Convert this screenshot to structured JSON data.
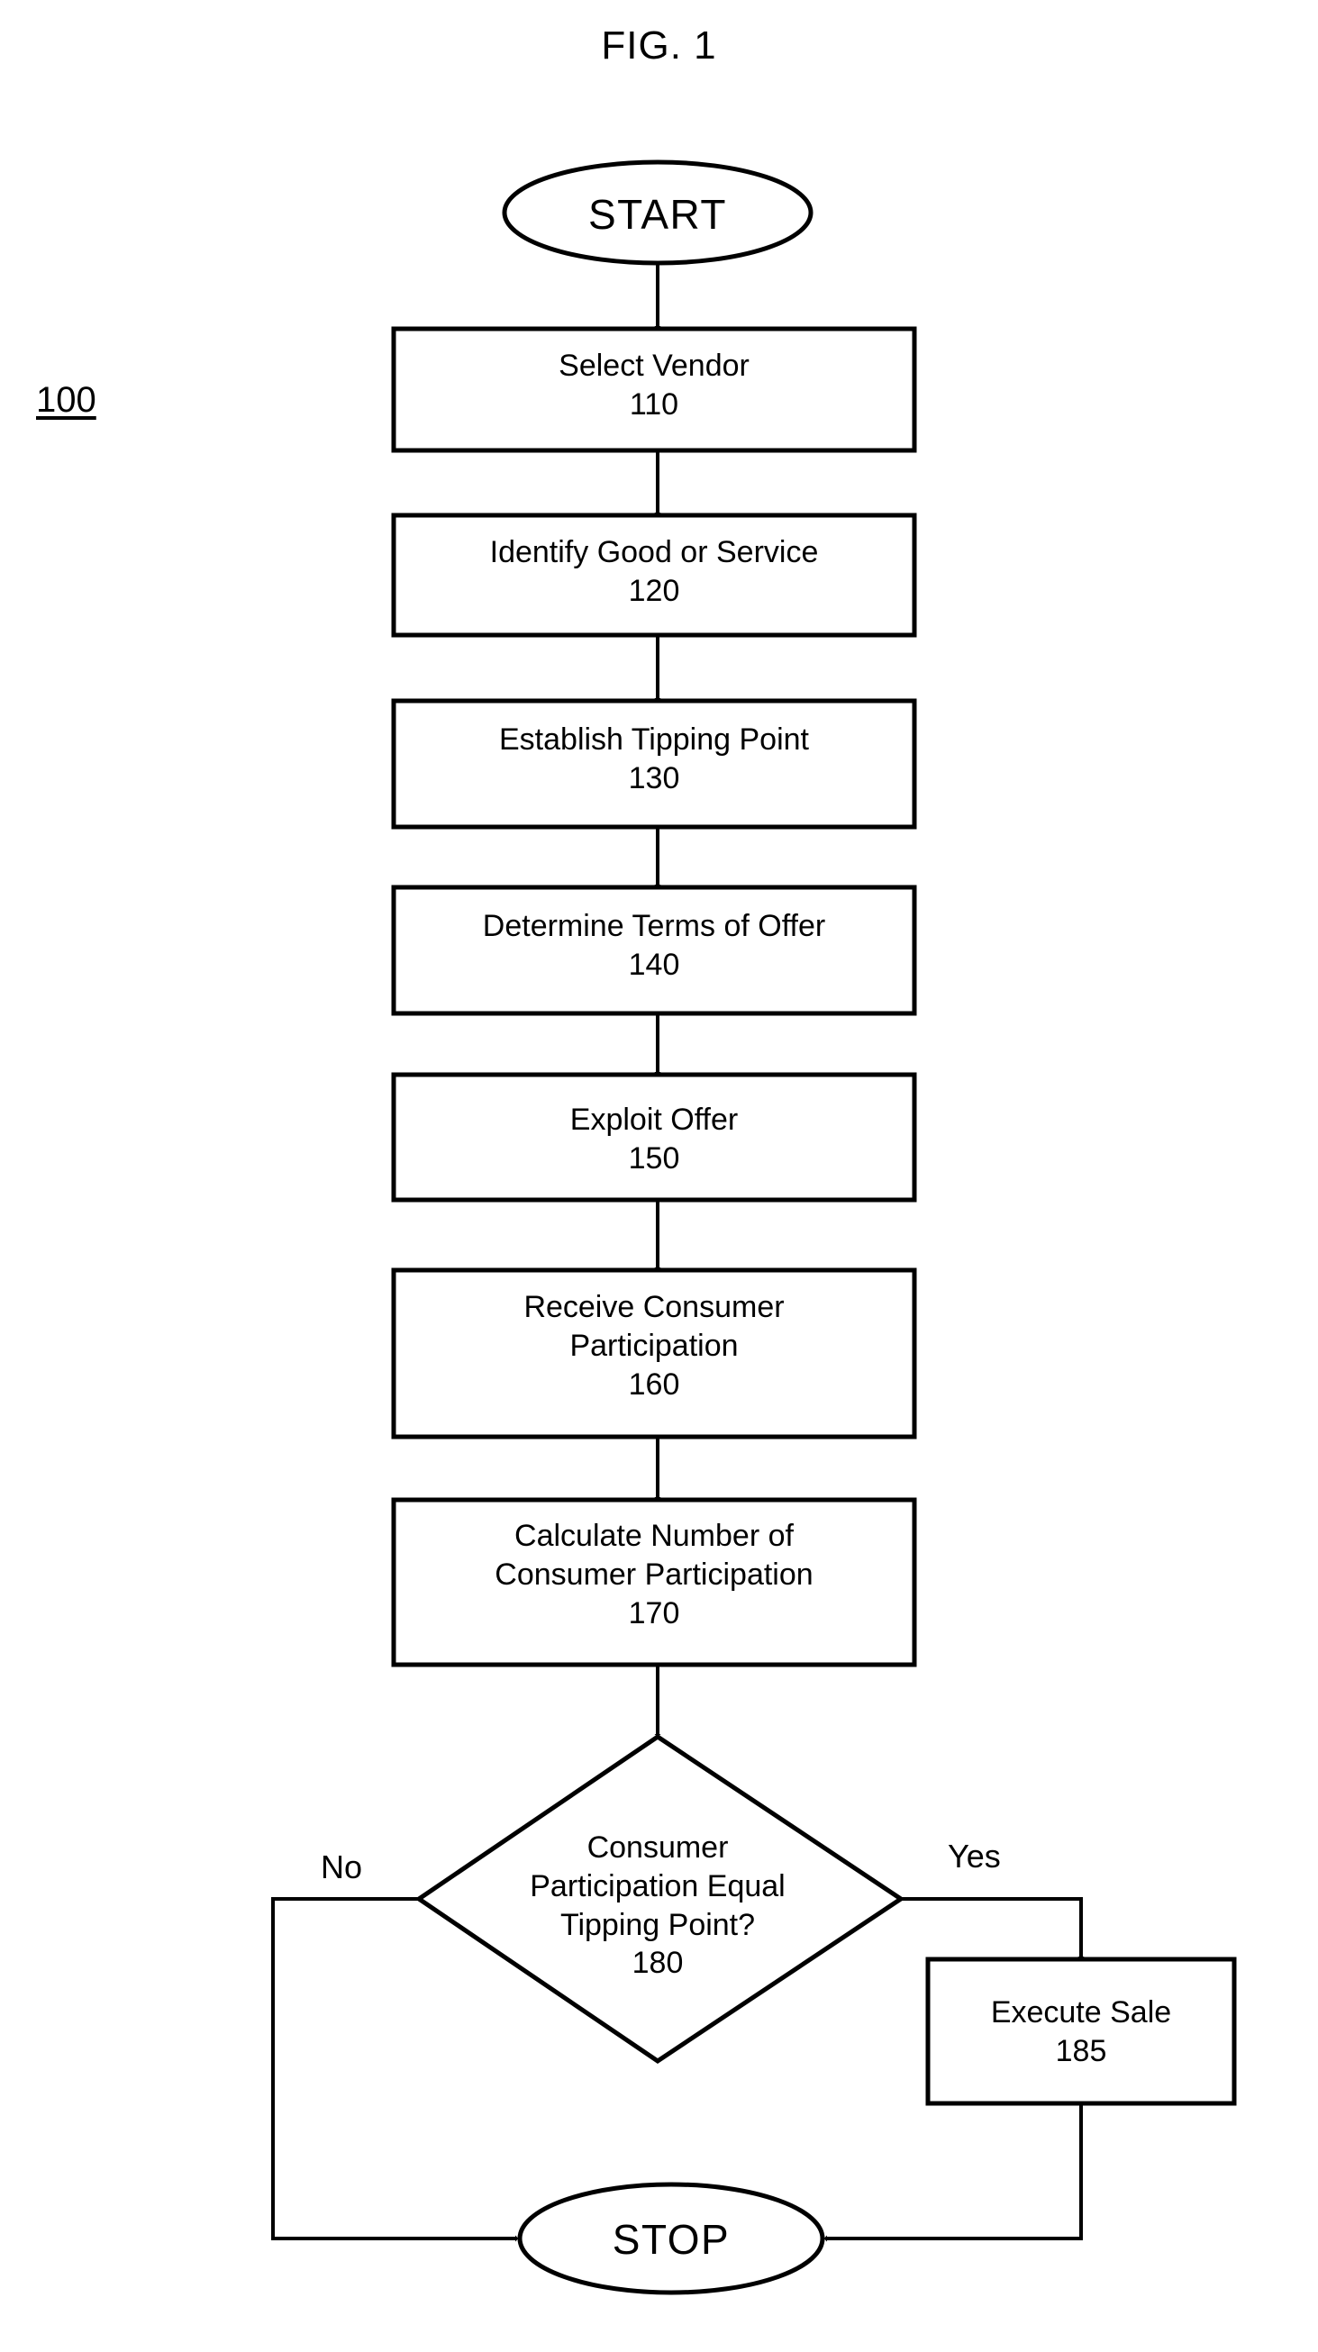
{
  "figure": {
    "title": "FIG. 1",
    "reference_numeral": "100"
  },
  "nodes": {
    "start": {
      "label": "START",
      "shape": "terminator"
    },
    "step110": {
      "label": "Select Vendor",
      "numeral": "110",
      "shape": "process"
    },
    "step120": {
      "label": "Identify Good or Service",
      "numeral": "120",
      "shape": "process"
    },
    "step130": {
      "label": "Establish Tipping Point",
      "numeral": "130",
      "shape": "process"
    },
    "step140": {
      "label": "Determine Terms of Offer",
      "numeral": "140",
      "shape": "process"
    },
    "step150": {
      "label": "Exploit Offer",
      "numeral": "150",
      "shape": "process"
    },
    "step160": {
      "label_line1": "Receive Consumer",
      "label_line2": "Participation",
      "numeral": "160",
      "shape": "process"
    },
    "step170": {
      "label_line1": "Calculate Number of",
      "label_line2": "Consumer Participation",
      "numeral": "170",
      "shape": "process"
    },
    "decision180": {
      "label_line1": "Consumer",
      "label_line2": "Participation Equal",
      "label_line3": "Tipping Point?",
      "numeral": "180",
      "shape": "decision"
    },
    "step185": {
      "label": "Execute Sale",
      "numeral": "185",
      "shape": "process"
    },
    "stop": {
      "label": "STOP",
      "shape": "terminator"
    }
  },
  "branches": {
    "no": "No",
    "yes": "Yes"
  },
  "style": {
    "stroke": "#000000",
    "fill": "#ffffff",
    "background": "#ffffff"
  }
}
